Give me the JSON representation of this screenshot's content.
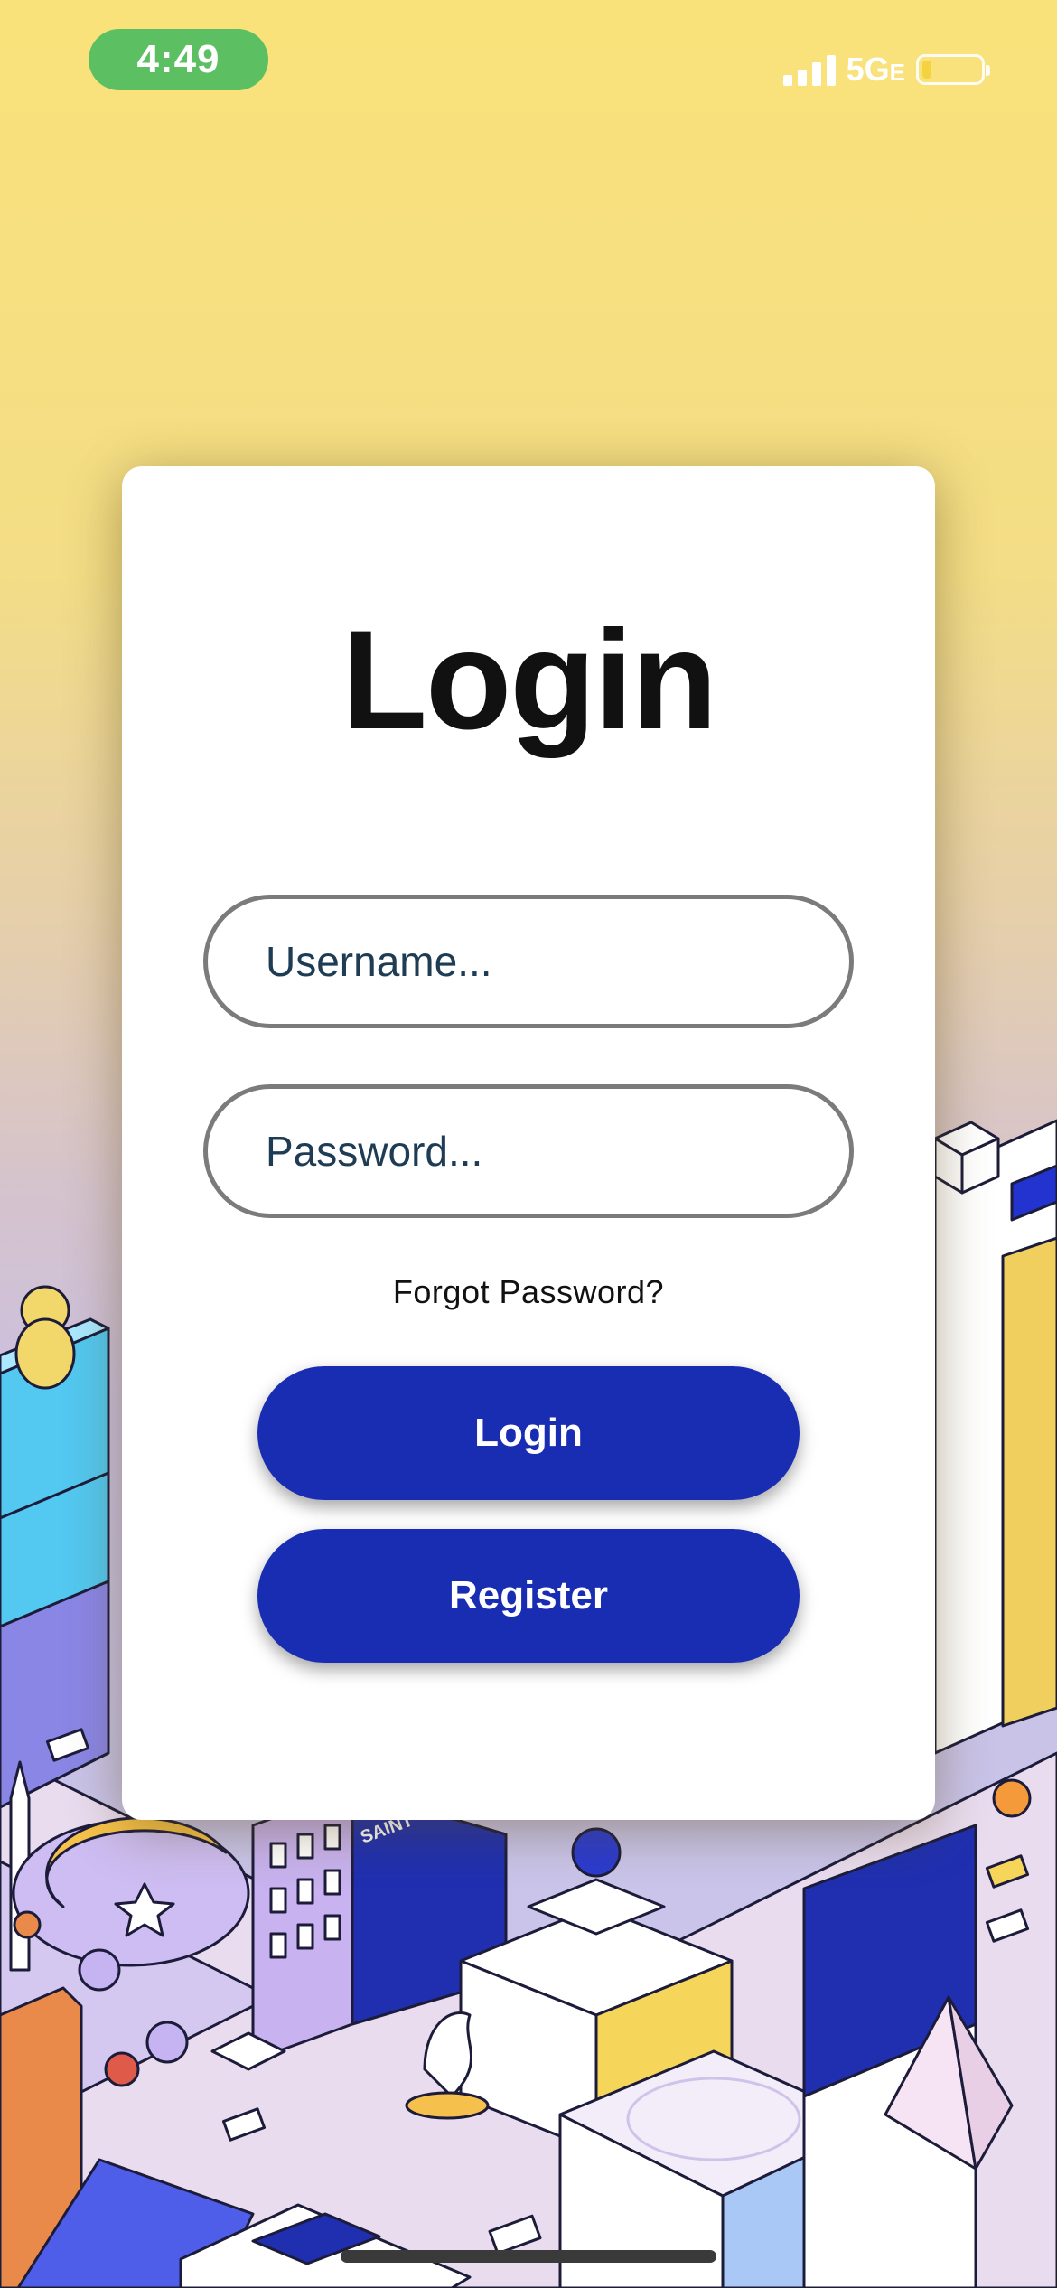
{
  "status_bar": {
    "time": "4:49",
    "network": "5G",
    "network_suffix": "E",
    "battery_level": 0.15,
    "colors": {
      "time_pill": "#5cc063",
      "battery_fill": "#f5d23a"
    }
  },
  "login": {
    "title": "Login",
    "username_placeholder": "Username...",
    "password_placeholder": "Password...",
    "forgot_password": "Forgot Password?",
    "login_button": "Login",
    "register_button": "Register",
    "colors": {
      "button": "#192db2",
      "field_border": "#7b7b7b"
    }
  },
  "background": {
    "illustration": "isometric-city-illustration",
    "illustration_text": "SAINT"
  }
}
